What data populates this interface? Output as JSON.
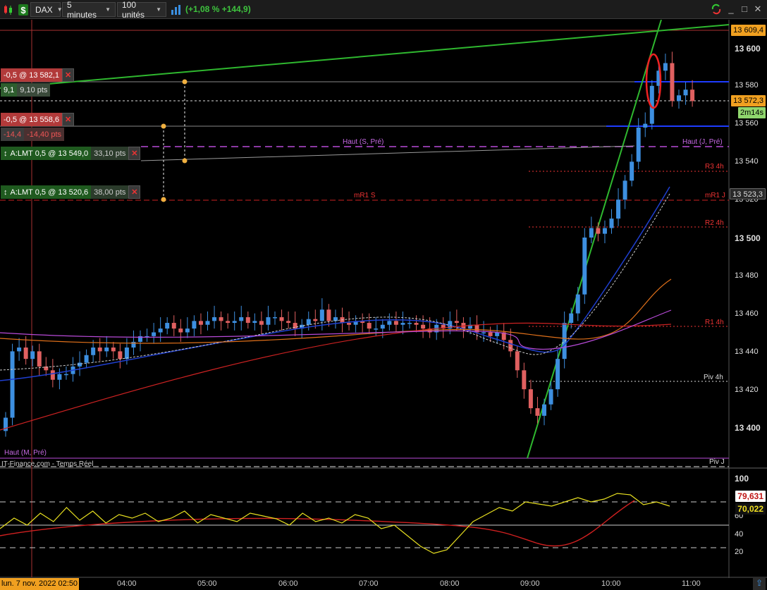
{
  "toolbar": {
    "symbol": "DAX",
    "interval": "5 minutes",
    "units": "100 unités",
    "performance": "(+1,08 % +144,9)"
  },
  "price_axis": {
    "ticks": [
      "13 600",
      "13 580",
      "13 560",
      "13 540",
      "13 520",
      "13 500",
      "13 480",
      "13 460",
      "13 440",
      "13 420",
      "13 400"
    ],
    "tags": {
      "top_line": "13 609,4",
      "last": "13 572,3",
      "countdown": "2m14s",
      "ma": "13 523,3"
    }
  },
  "oscillator_axis": {
    "ticks": [
      "100",
      "60",
      "40",
      "20"
    ],
    "tags": {
      "red": "79,631",
      "yellow": "70,022"
    }
  },
  "time_axis": {
    "ticks": [
      "04:00",
      "05:00",
      "06:00",
      "07:00",
      "08:00",
      "09:00",
      "10:00",
      "11:00"
    ],
    "cursor": "lun. 7 nov. 2022 02:50"
  },
  "orders": [
    {
      "label": "-0,5 @ 13 582,1",
      "pnl": "9,1",
      "pnl_pts": "9,10 pts"
    },
    {
      "label": "-0,5 @ 13 558,6",
      "pnl": "-14,4",
      "pnl_pts": "-14,40 pts"
    },
    {
      "label": "A:LMT  0,5 @ 13 549,0",
      "pts": "33,10 pts"
    },
    {
      "label": "A:LMT  0,5 @ 13 520,6",
      "pts": "38,00 pts"
    }
  ],
  "annotations": {
    "haut_s_pre": "Haut (S, Pré)",
    "haut_j_pre": "Haut (J, Pré)",
    "r3_4h": "R3 4h",
    "mr1_s": "mR1 S",
    "mr1_j": "mR1 J",
    "r2_4h": "R2 4h",
    "r1_4h": "R1 4h",
    "piv_4h": "Piv 4h",
    "haut_m_pre": "Haut (M, Pré)",
    "piv_j": "Piv J",
    "source": "IT-Finance.com - Temps Réel"
  },
  "colors": {
    "up": "#3d8fe0",
    "down": "#e06060",
    "trend": "#2fb82f",
    "purple": "#b84ad8"
  }
}
